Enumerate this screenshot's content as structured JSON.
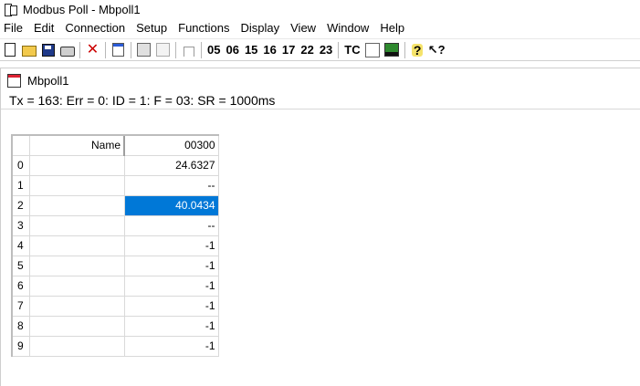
{
  "window": {
    "title": "Modbus Poll - Mbpoll1"
  },
  "menu": [
    "File",
    "Edit",
    "Connection",
    "Setup",
    "Functions",
    "Display",
    "View",
    "Window",
    "Help"
  ],
  "toolbar": {
    "icons": [
      "new-document",
      "open-folder",
      "save",
      "print",
      "delete",
      "window",
      "connect",
      "disconnect",
      "single-read"
    ],
    "function_codes": [
      "05",
      "06",
      "15",
      "16",
      "17",
      "22",
      "23"
    ],
    "tc_label": "TC",
    "help_icons": [
      "picture",
      "chart",
      "help",
      "whats-this"
    ]
  },
  "child": {
    "title": "Mbpoll1",
    "status": "Tx = 163: Err = 0: ID = 1: F = 03: SR = 1000ms"
  },
  "grid": {
    "header_name": "Name",
    "header_value": "00300",
    "rows": [
      {
        "index": "0",
        "name": "",
        "value": "24.6327"
      },
      {
        "index": "1",
        "name": "",
        "value": "--"
      },
      {
        "index": "2",
        "name": "",
        "value": "40.0434",
        "selected": true
      },
      {
        "index": "3",
        "name": "",
        "value": "--"
      },
      {
        "index": "4",
        "name": "",
        "value": "-1"
      },
      {
        "index": "5",
        "name": "",
        "value": "-1"
      },
      {
        "index": "6",
        "name": "",
        "value": "-1"
      },
      {
        "index": "7",
        "name": "",
        "value": "-1"
      },
      {
        "index": "8",
        "name": "",
        "value": "-1"
      },
      {
        "index": "9",
        "name": "",
        "value": "-1"
      }
    ]
  },
  "colors": {
    "selection": "#0078d7"
  }
}
